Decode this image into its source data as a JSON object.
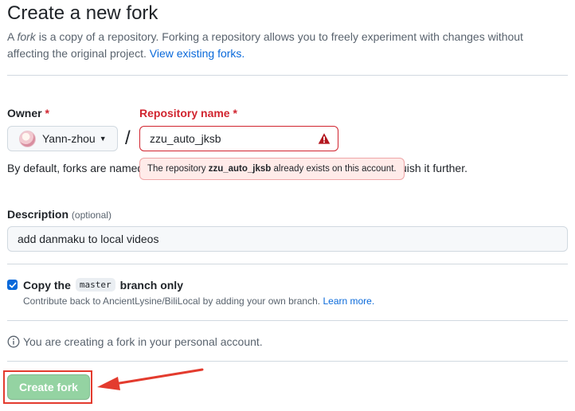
{
  "page": {
    "title": "Create a new fork",
    "intro_prefix": "A",
    "intro_fork_word": "fork",
    "intro_rest": "is a copy of a repository. Forking a repository allows you to freely experiment with changes without affecting the original project.",
    "view_forks_link": "View existing forks."
  },
  "owner": {
    "label": "Owner",
    "required_mark": "*",
    "selected": "Yann-zhou"
  },
  "repo": {
    "label": "Repository name",
    "required_mark": "*",
    "value": "zzu_auto_jksb",
    "error_prefix": "The repository",
    "error_name": "zzu_auto_jksb",
    "error_suffix": "already exists on this account."
  },
  "help_text": {
    "visible_start": "By default, forks are named",
    "visible_end": "ze the name to distinguish it further."
  },
  "description": {
    "label": "Description",
    "optional": "(optional)",
    "value": "add danmaku to local videos"
  },
  "copy_branch": {
    "checked": true,
    "label_prefix": "Copy the",
    "branch": "master",
    "label_suffix": "branch only",
    "help": "Contribute back to AncientLysine/BiliLocal by adding your own branch.",
    "learn_more": "Learn more."
  },
  "info_text": "You are creating a fork in your personal account.",
  "create_button": "Create fork",
  "colors": {
    "accent": "#0969da",
    "danger": "#d1242f",
    "create_button": "#94d3a2",
    "annotation": "#e33b2e"
  },
  "icons": [
    "warning-icon",
    "chevron-down-icon",
    "info-icon",
    "check-icon",
    "arrow-icon"
  ]
}
